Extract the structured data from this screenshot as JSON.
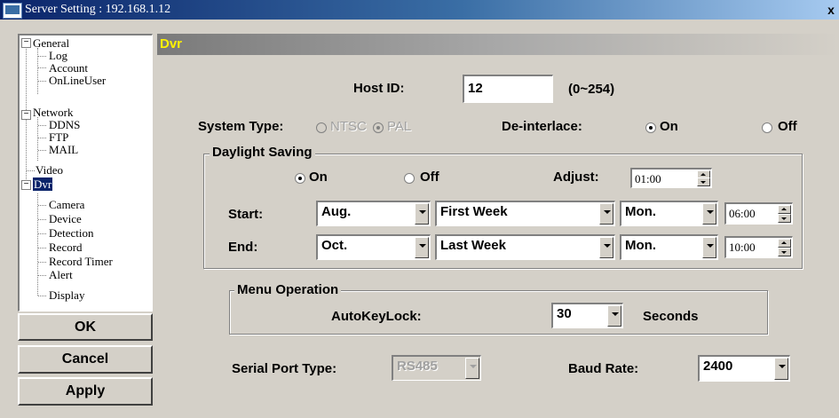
{
  "window": {
    "title": "Server Setting : 192.168.1.12",
    "close_label": "x"
  },
  "tree": {
    "general": "General",
    "log": "Log",
    "account": "Account",
    "onlineuser": "OnLineUser",
    "network": "Network",
    "ddns": "DDNS",
    "ftp": "FTP",
    "mail": "MAIL",
    "video": "Video",
    "dvr": "Dvr",
    "camera": "Camera",
    "device": "Device",
    "detection": "Detection",
    "record": "Record",
    "record_timer": "Record Timer",
    "alert": "Alert",
    "display": "Display",
    "minus": "−"
  },
  "buttons": {
    "ok": "OK",
    "cancel": "Cancel",
    "apply": "Apply"
  },
  "panel": {
    "header": "Dvr"
  },
  "host": {
    "label": "Host ID:",
    "value": "12",
    "range": "(0~254)"
  },
  "system": {
    "label": "System Type:",
    "ntsc": "NTSC",
    "pal": "PAL",
    "selected": "PAL"
  },
  "deinterlace": {
    "label": "De-interlace:",
    "on": "On",
    "off": "Off",
    "selected": "On"
  },
  "daylight": {
    "title": "Daylight Saving",
    "on": "On",
    "off": "Off",
    "selected": "On",
    "adjust_label": "Adjust:",
    "adjust_value": "01:00",
    "start_label": "Start:",
    "start_month": "Aug.",
    "start_week": "First Week",
    "start_day": "Mon.",
    "start_time": "06:00",
    "end_label": "End:",
    "end_month": "Oct.",
    "end_week": "Last Week",
    "end_day": "Mon.",
    "end_time": "10:00"
  },
  "menu_op": {
    "title": "Menu Operation",
    "label": "AutoKeyLock:",
    "value": "30",
    "unit": "Seconds"
  },
  "serial": {
    "label": "Serial Port Type:",
    "value": "RS485"
  },
  "baud": {
    "label": "Baud Rate:",
    "value": "2400"
  },
  "colors": {
    "header_text": "#fff200",
    "title_bar": "#0a246a",
    "selection": "#0a246a"
  }
}
